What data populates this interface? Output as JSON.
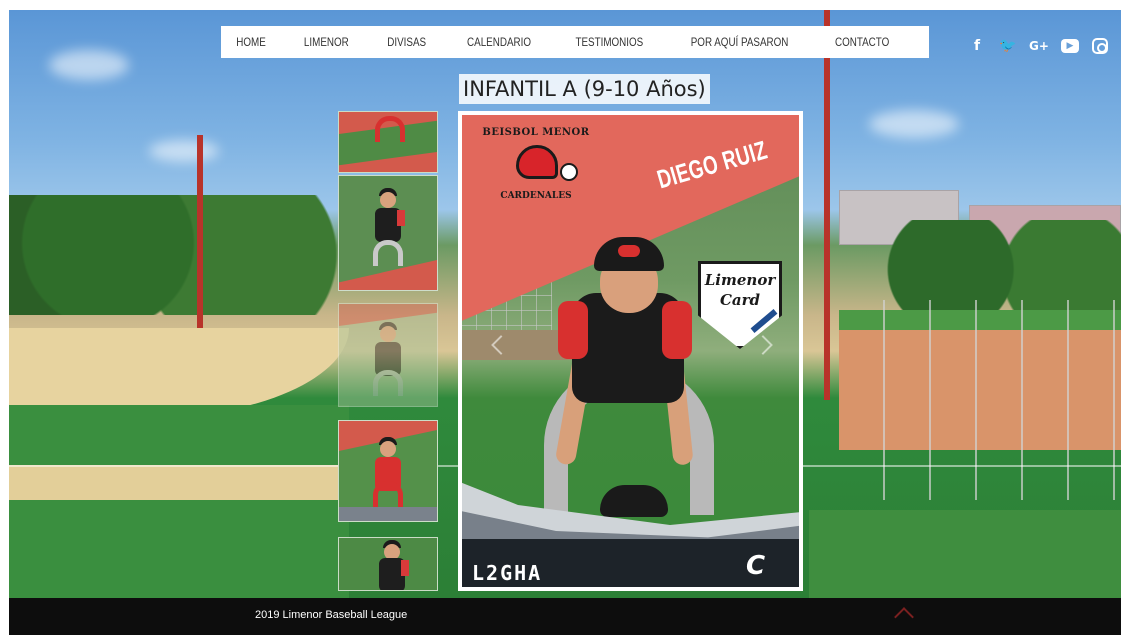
{
  "nav": {
    "items": [
      "HOME",
      "LIMENOR",
      "DIVISAS",
      "CALENDARIO",
      "TESTIMONIOS",
      "POR AQUÍ PASARON",
      "CONTACTO"
    ]
  },
  "social": {
    "facebook": "f",
    "twitter": "🐦",
    "googleplus": "G+",
    "youtube": "▶"
  },
  "gallery": {
    "title": "INFANTIL A (9-10 Años)"
  },
  "card": {
    "logo_top": "BEISBOL MENOR",
    "logo_bottom": "CARDENALES",
    "player_name": "DIEGO RUIZ",
    "brand_line1": "Limenor",
    "brand_line2": "Card",
    "position": "L2GHA",
    "team_letter": "C"
  },
  "footer": {
    "copyright": "2019 Limenor Baseball League"
  },
  "colors": {
    "accent_red": "#e2685c",
    "jersey_red": "#d8302f",
    "footer_bg": "#0d0d0d"
  }
}
